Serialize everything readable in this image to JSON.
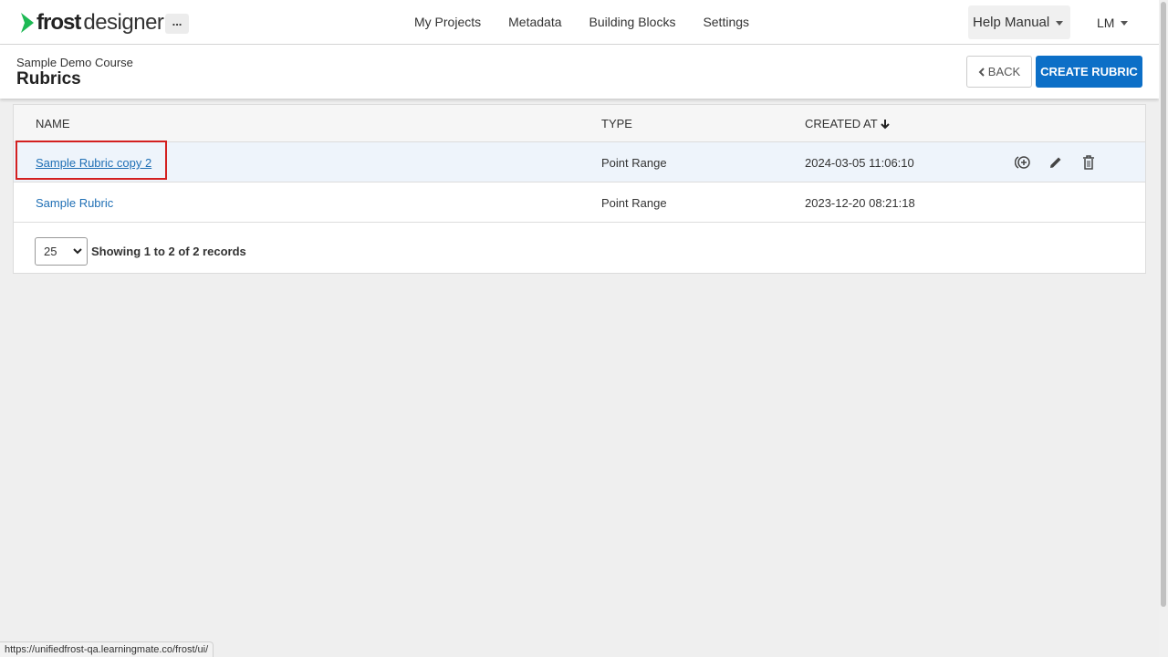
{
  "app": {
    "logo_bold": "frost",
    "logo_light": "designer",
    "more_label": "...",
    "brand_color": "#1db954"
  },
  "nav": {
    "items": [
      {
        "label": "My Projects"
      },
      {
        "label": "Metadata"
      },
      {
        "label": "Building Blocks"
      },
      {
        "label": "Settings"
      }
    ],
    "help_label": "Help Manual",
    "user_label": "LM"
  },
  "header": {
    "course": "Sample Demo Course",
    "title": "Rubrics",
    "back_label": "BACK",
    "create_label": "CREATE RUBRIC",
    "accent_color": "#0c6fc7"
  },
  "table": {
    "columns": [
      "NAME",
      "TYPE",
      "CREATED AT"
    ],
    "sort_indicator": "descending",
    "rows": [
      {
        "name": "Sample Rubric copy 2",
        "type": "Point Range",
        "created_at": "2024-03-05 11:06:10"
      },
      {
        "name": "Sample Rubric",
        "type": "Point Range",
        "created_at": "2023-12-20 08:21:18"
      }
    ],
    "row_actions": [
      "duplicate-icon",
      "edit-icon",
      "delete-icon"
    ],
    "page_size": "25",
    "records_text": "Showing 1 to 2 of 2 records"
  },
  "status_url": "https://unifiedfrost-qa.learningmate.co/frost/ui/"
}
